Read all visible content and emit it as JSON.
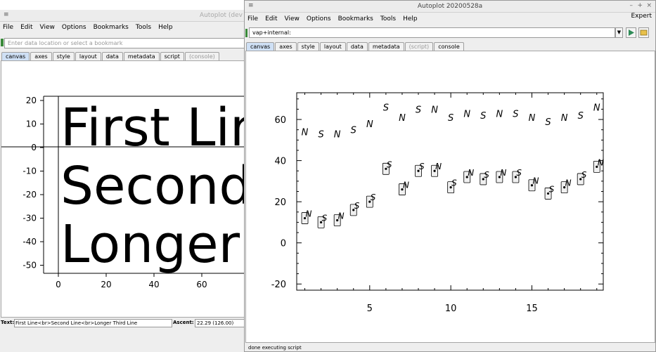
{
  "back_window": {
    "title": "Autoplot (dev",
    "menu": [
      "File",
      "Edit",
      "View",
      "Options",
      "Bookmarks",
      "Tools",
      "Help"
    ],
    "address_placeholder": "Enter data location or select a bookmark",
    "tabs": [
      "canvas",
      "axes",
      "style",
      "layout",
      "data",
      "metadata",
      "script",
      "(console)"
    ],
    "plot": {
      "text_lines": [
        "First Line",
        "Second Line",
        "Longer Third Line"
      ],
      "y_ticks": [
        "20",
        "10",
        "0",
        "-10",
        "-20",
        "-30",
        "-40",
        "-50"
      ],
      "x_ticks": [
        "0",
        "20",
        "40",
        "60"
      ]
    },
    "text_label": "Text:",
    "text_value": "First Line<br>Second Line<br>Longer Third Line",
    "ascent_label": "Ascent:",
    "ascent_value": "22.29 (126.00)"
  },
  "front_window": {
    "title": "Autoplot 20200528a",
    "menu": [
      "File",
      "Edit",
      "View",
      "Options",
      "Bookmarks",
      "Tools",
      "Help"
    ],
    "expert_label": "Expert",
    "address_value": "vap+internal:",
    "tabs": [
      "canvas",
      "axes",
      "style",
      "layout",
      "data",
      "metadata",
      "(script)",
      "console"
    ],
    "status": "done executing script"
  },
  "chart_data": {
    "type": "scatter",
    "title": "",
    "xlabel": "",
    "ylabel": "",
    "xlim": [
      0.5,
      19.4
    ],
    "ylim": [
      -23,
      73
    ],
    "x_ticks": [
      5,
      10,
      15
    ],
    "y_ticks": [
      -20,
      0,
      20,
      40,
      60
    ],
    "upper_symbols": [
      {
        "x": 1,
        "y": 54,
        "label": "N"
      },
      {
        "x": 2,
        "y": 53,
        "label": "S"
      },
      {
        "x": 3,
        "y": 53,
        "label": "N"
      },
      {
        "x": 4,
        "y": 55,
        "label": "S"
      },
      {
        "x": 5,
        "y": 58,
        "label": "N"
      },
      {
        "x": 6,
        "y": 66,
        "label": "S"
      },
      {
        "x": 7,
        "y": 61,
        "label": "N"
      },
      {
        "x": 8,
        "y": 65,
        "label": "S"
      },
      {
        "x": 9,
        "y": 65,
        "label": "N"
      },
      {
        "x": 10,
        "y": 61,
        "label": "S"
      },
      {
        "x": 11,
        "y": 63,
        "label": "N"
      },
      {
        "x": 12,
        "y": 62,
        "label": "S"
      },
      {
        "x": 13,
        "y": 63,
        "label": "N"
      },
      {
        "x": 14,
        "y": 63,
        "label": "S"
      },
      {
        "x": 15,
        "y": 61,
        "label": "N"
      },
      {
        "x": 16,
        "y": 59,
        "label": "S"
      },
      {
        "x": 17,
        "y": 61,
        "label": "N"
      },
      {
        "x": 18,
        "y": 62,
        "label": "S"
      },
      {
        "x": 19,
        "y": 66,
        "label": "N"
      }
    ],
    "lower_points": [
      {
        "x": 1,
        "y": 12,
        "label": "N"
      },
      {
        "x": 2,
        "y": 10,
        "label": "S"
      },
      {
        "x": 3,
        "y": 11,
        "label": "N"
      },
      {
        "x": 4,
        "y": 16,
        "label": "S"
      },
      {
        "x": 5,
        "y": 20,
        "label": "S"
      },
      {
        "x": 6,
        "y": 36,
        "label": "S"
      },
      {
        "x": 7,
        "y": 26,
        "label": "N"
      },
      {
        "x": 8,
        "y": 35,
        "label": "S"
      },
      {
        "x": 9,
        "y": 35,
        "label": "N"
      },
      {
        "x": 10,
        "y": 27,
        "label": "S"
      },
      {
        "x": 11,
        "y": 32,
        "label": "N"
      },
      {
        "x": 12,
        "y": 31,
        "label": "S"
      },
      {
        "x": 13,
        "y": 32,
        "label": "N"
      },
      {
        "x": 14,
        "y": 32,
        "label": "S"
      },
      {
        "x": 15,
        "y": 28,
        "label": "N"
      },
      {
        "x": 16,
        "y": 24,
        "label": "S"
      },
      {
        "x": 17,
        "y": 27,
        "label": "N"
      },
      {
        "x": 18,
        "y": 31,
        "label": "S"
      },
      {
        "x": 19,
        "y": 37,
        "label": "N"
      }
    ]
  }
}
